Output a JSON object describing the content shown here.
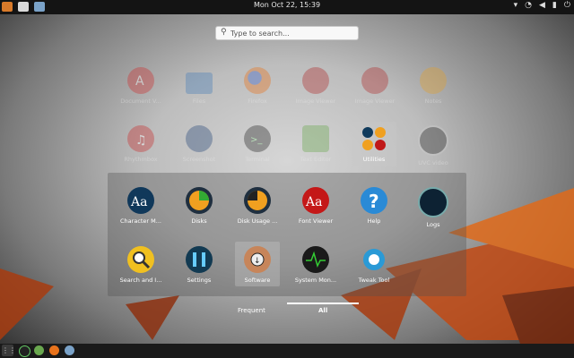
{
  "topbar": {
    "clock": "Mon Oct 22, 15:39"
  },
  "search": {
    "placeholder": "Type to search..."
  },
  "apps_dim": [
    {
      "label": "Document V...",
      "icon": "document-viewer-icon"
    },
    {
      "label": "Files",
      "icon": "files-icon"
    },
    {
      "label": "Firefox",
      "icon": "firefox-icon"
    },
    {
      "label": "Image Viewer",
      "icon": "image-viewer-icon"
    },
    {
      "label": "Image Viewer",
      "icon": "image-viewer-icon"
    },
    {
      "label": "Notes",
      "icon": "notes-icon"
    },
    {
      "label": "Rhythmbox",
      "icon": "rhythmbox-icon"
    },
    {
      "label": "Screenshot",
      "icon": "screenshot-icon"
    },
    {
      "label": "Terminal",
      "icon": "terminal-icon"
    },
    {
      "label": "Text Editor",
      "icon": "text-editor-icon"
    },
    {
      "label": "Utilities",
      "icon": "utilities-folder-icon"
    },
    {
      "label": "UVC video",
      "icon": "uvc-video-icon"
    }
  ],
  "folder_apps": [
    {
      "label": "Character M...",
      "icon": "character-map-icon"
    },
    {
      "label": "Disks",
      "icon": "disks-icon"
    },
    {
      "label": "Disk Usage ...",
      "icon": "disk-usage-icon"
    },
    {
      "label": "Font Viewer",
      "icon": "font-viewer-icon"
    },
    {
      "label": "Help",
      "icon": "help-icon"
    },
    {
      "label": "Logs",
      "icon": "logs-icon"
    },
    {
      "label": "Search and I...",
      "icon": "search-and-indexing-icon"
    },
    {
      "label": "Settings",
      "icon": "settings-icon"
    },
    {
      "label": "Software",
      "icon": "software-icon"
    },
    {
      "label": "System Mon...",
      "icon": "system-monitor-icon"
    },
    {
      "label": "Tweak Tool",
      "icon": "tweak-tool-icon"
    }
  ],
  "tabs": {
    "frequent": "Frequent",
    "all": "All"
  },
  "dock": {
    "apps_glyph": "⋮⋮"
  }
}
